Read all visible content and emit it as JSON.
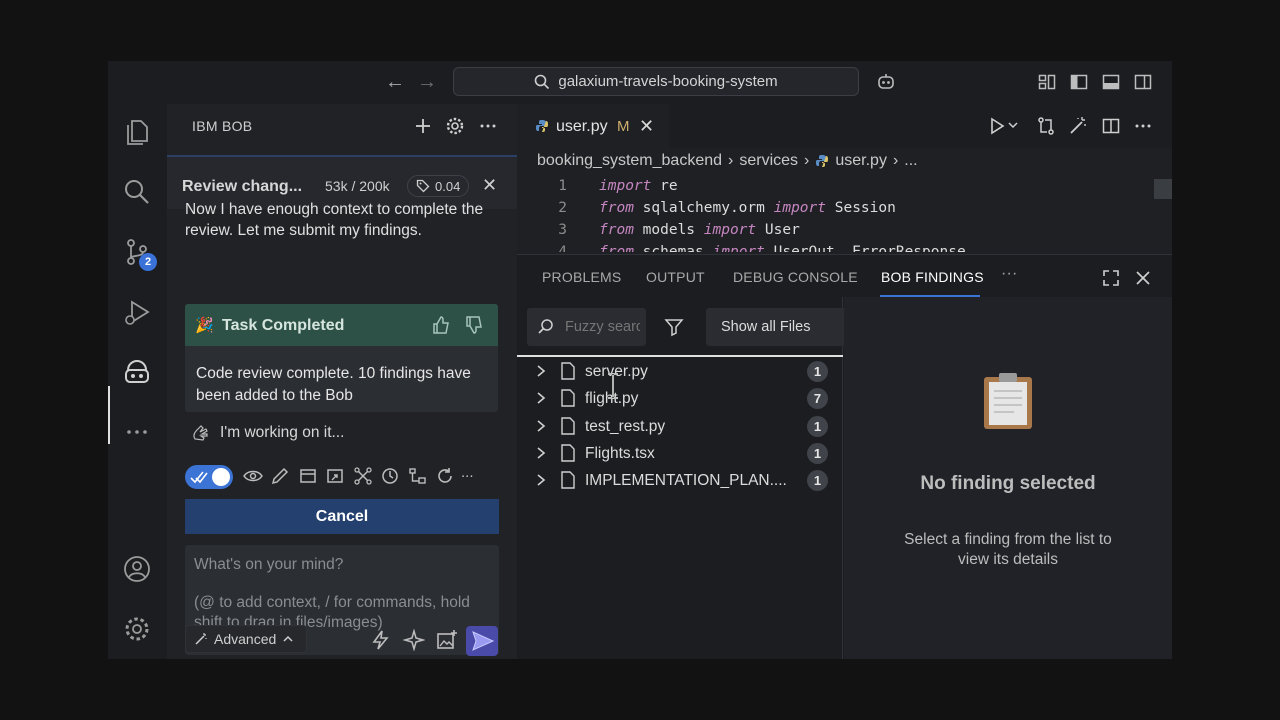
{
  "titlebar": {
    "search_text": "galaxium-travels-booking-system",
    "icons": [
      "arrow-left-icon",
      "arrow-right-icon",
      "search-icon",
      "copilot-icon",
      "layout-icon",
      "toggle-sidebar-icon",
      "toggle-panel-icon",
      "toggle-secondary-sidebar-icon"
    ]
  },
  "activity_bar": {
    "items": [
      "explorer-icon",
      "search-icon",
      "source-control-icon",
      "run-debug-icon",
      "bob-robot-icon",
      "more-icon",
      "account-icon",
      "settings-gear-icon"
    ],
    "source_control_badge": "2"
  },
  "sidebar": {
    "title": "IBM BOB",
    "review": {
      "title": "Review chang...",
      "tokens": "53k / 200k",
      "cost": "0.04"
    },
    "message": "Now I have enough context to complete the review. Let me submit my findings.",
    "task": {
      "emoji": "🎉",
      "title": "Task Completed",
      "body": "Code review complete. 10 findings have been added to the Bob"
    },
    "working_text": "I'm working on it...",
    "toolbar_more": "...",
    "cancel_label": "Cancel",
    "prompt_placeholder": "What's on your mind?",
    "prompt_hint": "(@ to add context, / for commands, hold shift to drag in files/images)",
    "advanced_label": "Advanced"
  },
  "editor": {
    "tab": {
      "label": "user.py",
      "modified": "M"
    },
    "breadcrumb": [
      "booking_system_backend",
      "services",
      "user.py",
      "..."
    ],
    "code_lines": [
      {
        "num": "1",
        "kw1": "import",
        "rest1": " re",
        "kw2": "",
        "rest2": ""
      },
      {
        "num": "2",
        "kw1": "from",
        "rest1": " sqlalchemy.orm ",
        "kw2": "import",
        "rest2": " Session"
      },
      {
        "num": "3",
        "kw1": "from",
        "rest1": " models ",
        "kw2": "import",
        "rest2": " User"
      },
      {
        "num": "4",
        "kw1": "from",
        "rest1": " schemas ",
        "kw2": "import",
        "rest2": " UserOut, ErrorResponse"
      }
    ]
  },
  "panel": {
    "tabs": [
      "PROBLEMS",
      "OUTPUT",
      "DEBUG CONSOLE",
      "BOB FINDINGS"
    ],
    "more": "···",
    "fuzzy_placeholder": "Fuzzy search",
    "show_all_label": "Show all Files",
    "files": [
      {
        "name": "server.py",
        "count": "1"
      },
      {
        "name": "flight.py",
        "count": "7"
      },
      {
        "name": "test_rest.py",
        "count": "1"
      },
      {
        "name": "Flights.tsx",
        "count": "1"
      },
      {
        "name": "IMPLEMENTATION_PLAN....",
        "count": "1"
      }
    ],
    "detail_title": "No finding selected",
    "detail_desc": "Select a finding from the list to view its details"
  }
}
